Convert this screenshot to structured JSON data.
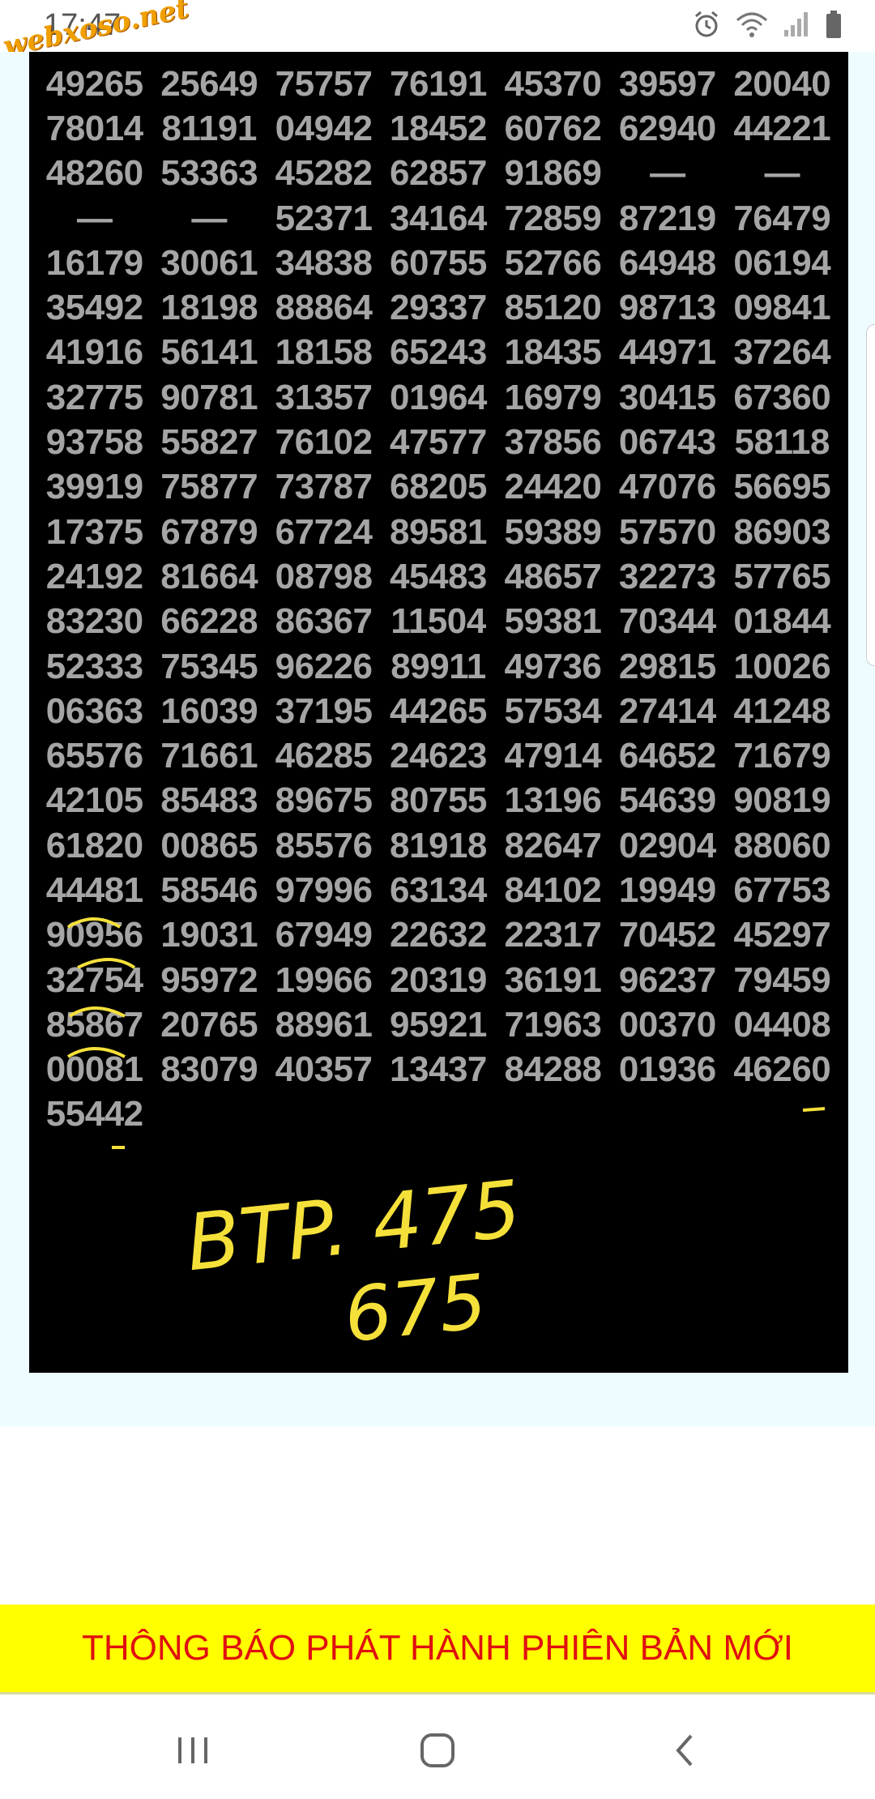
{
  "status_bar": {
    "time": "17:47",
    "watermark": "webxoso.net",
    "icons": [
      "alarm-icon",
      "wifi-icon",
      "signal-icon",
      "battery-icon"
    ]
  },
  "lottery_rows": [
    [
      "49265",
      "25649",
      "75757",
      "76191",
      "45370",
      "39597",
      "20040"
    ],
    [
      "78014",
      "81191",
      "04942",
      "18452",
      "60762",
      "62940",
      "44221"
    ],
    [
      "48260",
      "53363",
      "45282",
      "62857",
      "91869",
      "—",
      "—"
    ],
    [
      "—",
      "—",
      "52371",
      "34164",
      "72859",
      "87219",
      "76479"
    ],
    [
      "16179",
      "30061",
      "34838",
      "60755",
      "52766",
      "64948",
      "06194"
    ],
    [
      "35492",
      "18198",
      "88864",
      "29337",
      "85120",
      "98713",
      "09841"
    ],
    [
      "41916",
      "56141",
      "18158",
      "65243",
      "18435",
      "44971",
      "37264"
    ],
    [
      "32775",
      "90781",
      "31357",
      "01964",
      "16979",
      "30415",
      "67360"
    ],
    [
      "93758",
      "55827",
      "76102",
      "47577",
      "37856",
      "06743",
      "58118"
    ],
    [
      "39919",
      "75877",
      "73787",
      "68205",
      "24420",
      "47076",
      "56695"
    ],
    [
      "17375",
      "67879",
      "67724",
      "89581",
      "59389",
      "57570",
      "86903"
    ],
    [
      "24192",
      "81664",
      "08798",
      "45483",
      "48657",
      "32273",
      "57765"
    ],
    [
      "83230",
      "66228",
      "86367",
      "11504",
      "59381",
      "70344",
      "01844"
    ],
    [
      "52333",
      "75345",
      "96226",
      "89911",
      "49736",
      "29815",
      "10026"
    ],
    [
      "06363",
      "16039",
      "37195",
      "44265",
      "57534",
      "27414",
      "41248"
    ],
    [
      "65576",
      "71661",
      "46285",
      "24623",
      "47914",
      "64652",
      "71679"
    ],
    [
      "42105",
      "85483",
      "89675",
      "80755",
      "13196",
      "54639",
      "90819"
    ],
    [
      "61820",
      "00865",
      "85576",
      "81918",
      "82647",
      "02904",
      "88060"
    ],
    [
      "44481",
      "58546",
      "97996",
      "63134",
      "84102",
      "19949",
      "67753"
    ],
    [
      "90956",
      "19031",
      "67949",
      "22632",
      "22317",
      "70452",
      "45297"
    ],
    [
      "32754",
      "95972",
      "19966",
      "20319",
      "36191",
      "96237",
      "79459"
    ],
    [
      "85867",
      "20765",
      "88961",
      "95921",
      "71963",
      "00370",
      "04408"
    ],
    [
      "00081",
      "83079",
      "40357",
      "13437",
      "84288",
      "01936",
      "46260"
    ],
    [
      "55442",
      "",
      "",
      "",
      "",
      "",
      ""
    ]
  ],
  "handwriting": {
    "line1": "BTP. 475",
    "line2": "675",
    "color": "#f5e03a"
  },
  "notice": {
    "text": "THÔNG BÁO PHÁT HÀNH PHIÊN BẢN MỚI",
    "background": "#ffff00",
    "color": "#e01010"
  },
  "nav": {
    "icons": [
      "recent-apps-icon",
      "home-icon",
      "back-icon"
    ]
  }
}
